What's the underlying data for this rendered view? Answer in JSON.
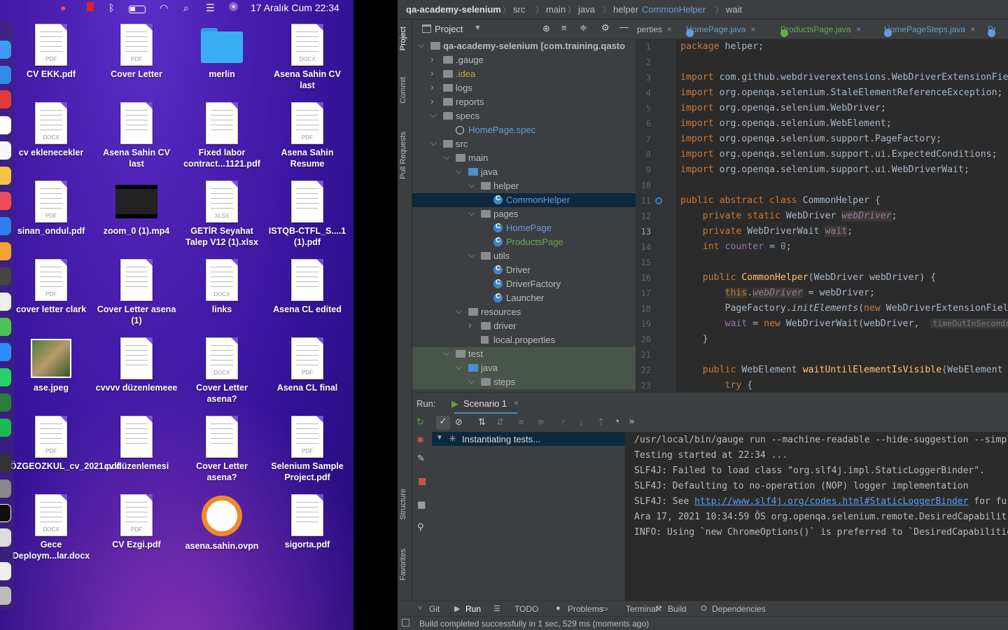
{
  "menubar": {
    "datetime": "17 Aralık Cum  22:34"
  },
  "desktop": {
    "items": [
      {
        "label": "CV EKK.pdf",
        "tag": "PDF"
      },
      {
        "label": "Cover Letter",
        "tag": "PDF"
      },
      {
        "label": "merlin",
        "tag": ""
      },
      {
        "label": "Asena Sahin CV last",
        "tag": "DOCX"
      },
      {
        "label": "cv eklenecekler",
        "tag": "DOCX"
      },
      {
        "label": "Asena Sahin CV last",
        "tag": ""
      },
      {
        "label": "Fixed labor contract...1121.pdf",
        "tag": ""
      },
      {
        "label": "Asena Sahin Resume",
        "tag": "PDF"
      },
      {
        "label": "sinan_ondul.pdf",
        "tag": "PDF"
      },
      {
        "label": "zoom_0 (1).mp4",
        "tag": ""
      },
      {
        "label": "GETİR Seyahat Talep V12 (1).xlsx",
        "tag": "XLSX"
      },
      {
        "label": "ISTQB-CTFL_S....1 (1).pdf",
        "tag": ""
      },
      {
        "label": "cover letter clark",
        "tag": "PDF"
      },
      {
        "label": "Cover Letter asena (1)",
        "tag": ""
      },
      {
        "label": "links",
        "tag": "DOCX"
      },
      {
        "label": "Asena CL edited",
        "tag": ""
      },
      {
        "label": "ase.jpeg",
        "tag": ""
      },
      {
        "label": "cvvvv düzenlemeee",
        "tag": ""
      },
      {
        "label": "Cover Letter asena?",
        "tag": "DOCX"
      },
      {
        "label": "Asena CL final",
        "tag": "PDF"
      },
      {
        "label": "ÖZGEOZKUL_cv_2021.pdf",
        "tag": "PDF"
      },
      {
        "label": "cv düzenlemesi",
        "tag": ""
      },
      {
        "label": "Cover Letter asena?",
        "tag": ""
      },
      {
        "label": "Selenium Sample Project.pdf",
        "tag": "PDF"
      },
      {
        "label": "Gece Deploym...lar.docx",
        "tag": "DOCX"
      },
      {
        "label": "CV Ezgi.pdf",
        "tag": "PDF"
      },
      {
        "label": "asena.sahin.ovpn",
        "tag": ""
      },
      {
        "label": "sigorta.pdf",
        "tag": ""
      }
    ]
  },
  "ide": {
    "breadcrumb": [
      "qa-academy-selenium",
      "src",
      "main",
      "java",
      "helper",
      "CommonHelper",
      "wait"
    ],
    "project_panel_title": "Project",
    "side_tabs": [
      "Project",
      "Commit",
      "Pull Requests",
      "Structure",
      "Favorites"
    ],
    "tree": [
      {
        "label": "qa-academy-selenium [com.training.qasto",
        "bold": true,
        "depth": 0,
        "arrow": "v"
      },
      {
        "label": ".gauge",
        "depth": 1,
        "arrow": ">"
      },
      {
        "label": ".idea",
        "depth": 1,
        "arrow": ">",
        "color": "#c8a24a"
      },
      {
        "label": "logs",
        "depth": 1,
        "arrow": ">"
      },
      {
        "label": "reports",
        "depth": 1,
        "arrow": ">"
      },
      {
        "label": "specs",
        "depth": 1,
        "arrow": "v"
      },
      {
        "label": "HomePage.spec",
        "depth": 2,
        "arrow": "",
        "color": "#6a9ad3",
        "kind": "spec"
      },
      {
        "label": "src",
        "depth": 1,
        "arrow": "v"
      },
      {
        "label": "main",
        "depth": 2,
        "arrow": "v"
      },
      {
        "label": "java",
        "depth": 3,
        "arrow": "v",
        "kind": "blue"
      },
      {
        "label": "helper",
        "depth": 4,
        "arrow": "v"
      },
      {
        "label": "CommonHelper",
        "depth": 5,
        "arrow": "",
        "kind": "class",
        "selected": true,
        "color": "#6a9ad3"
      },
      {
        "label": "pages",
        "depth": 4,
        "arrow": "v"
      },
      {
        "label": "HomePage",
        "depth": 5,
        "arrow": "",
        "kind": "class",
        "color": "#6a9ad3"
      },
      {
        "label": "ProductsPage",
        "depth": 5,
        "arrow": "",
        "kind": "class",
        "color": "#6aa84f"
      },
      {
        "label": "utils",
        "depth": 4,
        "arrow": "v"
      },
      {
        "label": "Driver",
        "depth": 5,
        "arrow": "",
        "kind": "class"
      },
      {
        "label": "DriverFactory",
        "depth": 5,
        "arrow": "",
        "kind": "class"
      },
      {
        "label": "Launcher",
        "depth": 5,
        "arrow": "",
        "kind": "class"
      },
      {
        "label": "resources",
        "depth": 3,
        "arrow": "v"
      },
      {
        "label": "driver",
        "depth": 4,
        "arrow": ">"
      },
      {
        "label": "local.properties",
        "depth": 4,
        "arrow": "",
        "kind": "file"
      },
      {
        "label": "test",
        "depth": 2,
        "arrow": "v",
        "green": true
      },
      {
        "label": "java",
        "depth": 3,
        "arrow": "v",
        "kind": "blue",
        "green": true
      },
      {
        "label": "steps",
        "depth": 4,
        "arrow": "v",
        "green": true
      }
    ],
    "editor_tabs": [
      {
        "label": "perties",
        "color": "#bbb"
      },
      {
        "label": "HomePage.java",
        "color": "#6a9ad3"
      },
      {
        "label": "ProductsPage.java",
        "color": "#6aa84f"
      },
      {
        "label": "HomePageSteps.java",
        "color": "#6a9ad3"
      },
      {
        "label": "Pr",
        "color": "#6a9ad3"
      }
    ],
    "line_numbers": [
      "1",
      "2",
      "3",
      "4",
      "5",
      "6",
      "7",
      "8",
      "9",
      "10",
      "11",
      "12",
      "13",
      "14",
      "15",
      "16",
      "17",
      "18",
      "19",
      "20",
      "21",
      "22",
      "23"
    ],
    "run": {
      "label": "Run:",
      "config": "Scenario 1",
      "test_status": "Instantiating tests...",
      "console": [
        "/usr/local/bin/gauge run --machine-readable --hide-suggestion --simpl",
        "Testing started at 22:34 ...",
        "SLF4J: Failed to load class \"org.slf4j.impl.StaticLoggerBinder\".",
        "SLF4J: Defaulting to no-operation (NOP) logger implementation",
        "Ara 17, 2021 10:34:59 ÖS org.openqa.selenium.remote.DesiredCapabilit",
        "INFO: Using `new ChromeOptions()` is preferred to `DesiredCapabilitie"
      ],
      "console_see": "SLF4J: See ",
      "console_link": "http://www.slf4j.org/codes.html#StaticLoggerBinder",
      "console_after_link": " for fur"
    },
    "bottom_tabs": [
      "Git",
      "Run",
      "TODO",
      "Problems",
      "Terminal",
      "Build",
      "Dependencies"
    ],
    "status": "Build completed successfully in 1 sec, 529 ms (moments ago)"
  }
}
